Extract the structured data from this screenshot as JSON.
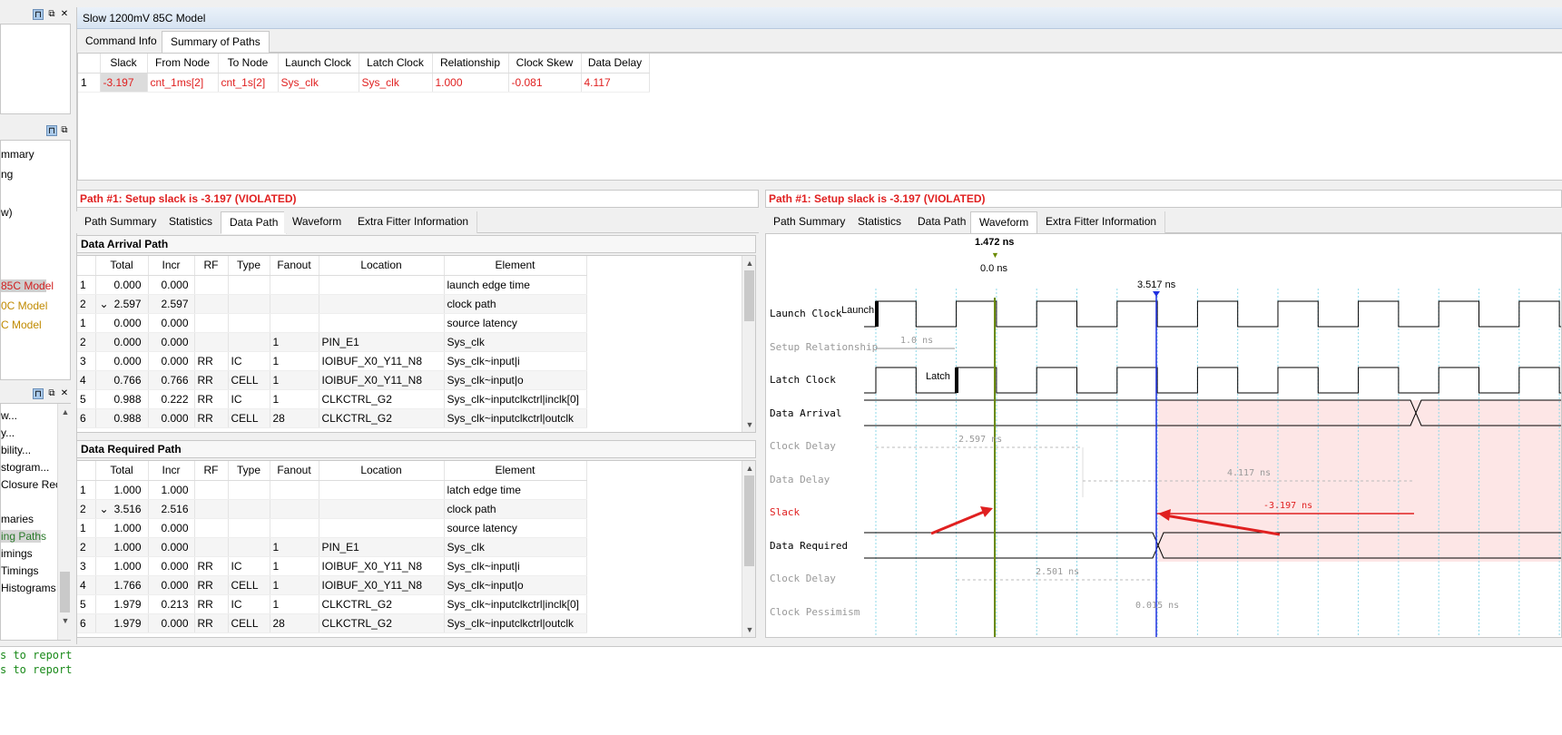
{
  "window": {
    "title": "Slow 1200mV 85C Model"
  },
  "left_panel": {
    "items_a": [
      "mmary",
      "ng",
      "w)"
    ],
    "items_b": [
      {
        "label": "85C Model",
        "color": "#d02020",
        "sel": true
      },
      {
        "label": "0C Model",
        "color": "#c08a00"
      },
      {
        "label": "C Model",
        "color": "#c08a00"
      }
    ],
    "items_c": [
      {
        "label": "w..."
      },
      {
        "label": "y..."
      },
      {
        "label": "bility..."
      },
      {
        "label": "stogram..."
      },
      {
        "label": "Closure Recor"
      },
      {
        "label": "maries"
      },
      {
        "label": "ing Paths",
        "color": "#2a7a2a",
        "sel": true
      },
      {
        "label": "imings"
      },
      {
        "label": "Timings"
      },
      {
        "label": " Histograms"
      }
    ]
  },
  "top_tabs": [
    "Command Info",
    "Summary of Paths"
  ],
  "summary_table": {
    "headers": [
      "Slack",
      "From Node",
      "To Node",
      "Launch Clock",
      "Latch Clock",
      "Relationship",
      "Clock Skew",
      "Data Delay"
    ],
    "rows": [
      {
        "n": "1",
        "cells": [
          "-3.197",
          "cnt_1ms[2]",
          "cnt_1s[2]",
          "Sys_clk",
          "Sys_clk",
          "1.000",
          "-0.081",
          "4.117"
        ]
      }
    ]
  },
  "path_header": "Path #1: Setup slack is -3.197 (VIOLATED)",
  "detail_tabs": [
    "Path Summary",
    "Statistics",
    "Data Path",
    "Waveform",
    "Extra Fitter Information"
  ],
  "arrival": {
    "title": "Data Arrival Path",
    "headers": [
      "Total",
      "Incr",
      "RF",
      "Type",
      "Fanout",
      "Location",
      "Element"
    ],
    "rows": [
      {
        "n": "1",
        "exp": "",
        "c": [
          "0.000",
          "0.000",
          "",
          "",
          "",
          "",
          "launch edge time"
        ]
      },
      {
        "n": "2",
        "exp": "⌄",
        "c": [
          "2.597",
          "2.597",
          "",
          "",
          "",
          "",
          "clock path"
        ]
      },
      {
        "n": "1",
        "exp": "",
        "c": [
          "0.000",
          "0.000",
          "",
          "",
          "",
          "",
          "source latency"
        ]
      },
      {
        "n": "2",
        "exp": "",
        "c": [
          "0.000",
          "0.000",
          "",
          "",
          "1",
          "PIN_E1",
          "Sys_clk"
        ]
      },
      {
        "n": "3",
        "exp": "",
        "c": [
          "0.000",
          "0.000",
          "RR",
          "IC",
          "1",
          "IOIBUF_X0_Y11_N8",
          "Sys_clk~input|i"
        ]
      },
      {
        "n": "4",
        "exp": "",
        "c": [
          "0.766",
          "0.766",
          "RR",
          "CELL",
          "1",
          "IOIBUF_X0_Y11_N8",
          "Sys_clk~input|o"
        ]
      },
      {
        "n": "5",
        "exp": "",
        "c": [
          "0.988",
          "0.222",
          "RR",
          "IC",
          "1",
          "CLKCTRL_G2",
          "Sys_clk~inputclkctrl|inclk[0]"
        ]
      },
      {
        "n": "6",
        "exp": "",
        "c": [
          "0.988",
          "0.000",
          "RR",
          "CELL",
          "28",
          "CLKCTRL_G2",
          "Sys_clk~inputclkctrl|outclk"
        ]
      }
    ]
  },
  "required": {
    "title": "Data Required Path",
    "headers": [
      "Total",
      "Incr",
      "RF",
      "Type",
      "Fanout",
      "Location",
      "Element"
    ],
    "rows": [
      {
        "n": "1",
        "exp": "",
        "c": [
          "1.000",
          "1.000",
          "",
          "",
          "",
          "",
          "latch edge time"
        ]
      },
      {
        "n": "2",
        "exp": "⌄",
        "c": [
          "3.516",
          "2.516",
          "",
          "",
          "",
          "",
          "clock path"
        ]
      },
      {
        "n": "1",
        "exp": "",
        "c": [
          "1.000",
          "0.000",
          "",
          "",
          "",
          "",
          "source latency"
        ]
      },
      {
        "n": "2",
        "exp": "",
        "c": [
          "1.000",
          "0.000",
          "",
          "",
          "1",
          "PIN_E1",
          "Sys_clk"
        ]
      },
      {
        "n": "3",
        "exp": "",
        "c": [
          "1.000",
          "0.000",
          "RR",
          "IC",
          "1",
          "IOIBUF_X0_Y11_N8",
          "Sys_clk~input|i"
        ]
      },
      {
        "n": "4",
        "exp": "",
        "c": [
          "1.766",
          "0.000",
          "RR",
          "CELL",
          "1",
          "IOIBUF_X0_Y11_N8",
          "Sys_clk~input|o"
        ]
      },
      {
        "n": "5",
        "exp": "",
        "c": [
          "1.979",
          "0.213",
          "RR",
          "IC",
          "1",
          "CLKCTRL_G2",
          "Sys_clk~inputclkctrl|inclk[0]"
        ]
      },
      {
        "n": "6",
        "exp": "",
        "c": [
          "1.979",
          "0.000",
          "RR",
          "CELL",
          "28",
          "CLKCTRL_G2",
          "Sys_clk~inputclkctrl|outclk"
        ]
      }
    ]
  },
  "waveform": {
    "marker_a_time": "1.472 ns",
    "marker_a_sub": "0.0 ns",
    "marker_b_time": "3.517 ns",
    "rows": [
      {
        "label": "Launch Clock",
        "style": "normal"
      },
      {
        "label": "Setup Relationship",
        "style": "dim"
      },
      {
        "label": "Latch Clock",
        "style": "normal"
      },
      {
        "label": "Data Arrival",
        "style": "normal"
      },
      {
        "label": "Clock Delay",
        "style": "dim"
      },
      {
        "label": "Data Delay",
        "style": "dim"
      },
      {
        "label": "Slack",
        "style": "red"
      },
      {
        "label": "Data Required",
        "style": "normal"
      },
      {
        "label": "Clock Delay",
        "style": "dim"
      },
      {
        "label": "Clock Pessimism",
        "style": "dim"
      }
    ],
    "launch_tag": "Launch",
    "latch_tag": "Latch",
    "setup_rel": "1.0 ns",
    "arr_clock_delay": "2.597 ns",
    "data_delay": "4.117 ns",
    "slack": "-3.197 ns",
    "req_clock_delay": "2.501 ns",
    "pessimism": "0.015 ns"
  },
  "console": [
    "s to report",
    "s to report"
  ]
}
